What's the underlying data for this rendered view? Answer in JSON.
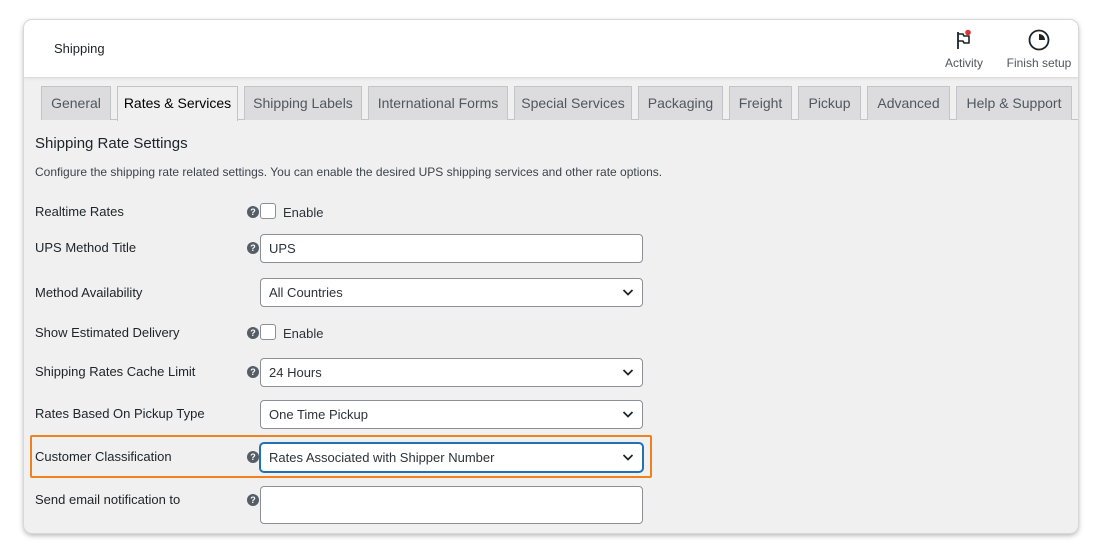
{
  "header": {
    "title": "Shipping",
    "activity_label": "Activity",
    "finish_label": "Finish setup"
  },
  "tabs": [
    {
      "label": "General"
    },
    {
      "label": "Rates & Services"
    },
    {
      "label": "Shipping Labels"
    },
    {
      "label": "International Forms"
    },
    {
      "label": "Special Services"
    },
    {
      "label": "Packaging"
    },
    {
      "label": "Freight"
    },
    {
      "label": "Pickup"
    },
    {
      "label": "Advanced"
    },
    {
      "label": "Help & Support"
    }
  ],
  "active_tab": "Rates & Services",
  "section": {
    "title": "Shipping Rate Settings",
    "description": "Configure the shipping rate related settings. You can enable the desired UPS shipping services and other rate options."
  },
  "fields": {
    "realtime_rates": {
      "label": "Realtime Rates",
      "checkbox_label": "Enable",
      "checked": false
    },
    "method_title": {
      "label": "UPS Method Title",
      "value": "UPS"
    },
    "method_availability": {
      "label": "Method Availability",
      "value": "All Countries"
    },
    "estimated_delivery": {
      "label": "Show Estimated Delivery",
      "checkbox_label": "Enable",
      "checked": false
    },
    "cache_limit": {
      "label": "Shipping Rates Cache Limit",
      "value": "24 Hours"
    },
    "pickup_type": {
      "label": "Rates Based On Pickup Type",
      "value": "One Time Pickup"
    },
    "customer_classification": {
      "label": "Customer Classification",
      "value": "Rates Associated with Shipper Number"
    },
    "email_notification": {
      "label": "Send email notification to",
      "value": ""
    }
  },
  "help_glyph": "?",
  "colors": {
    "highlight": "#f0821e",
    "focus": "#2271b1",
    "notification_dot": "#d63638"
  }
}
